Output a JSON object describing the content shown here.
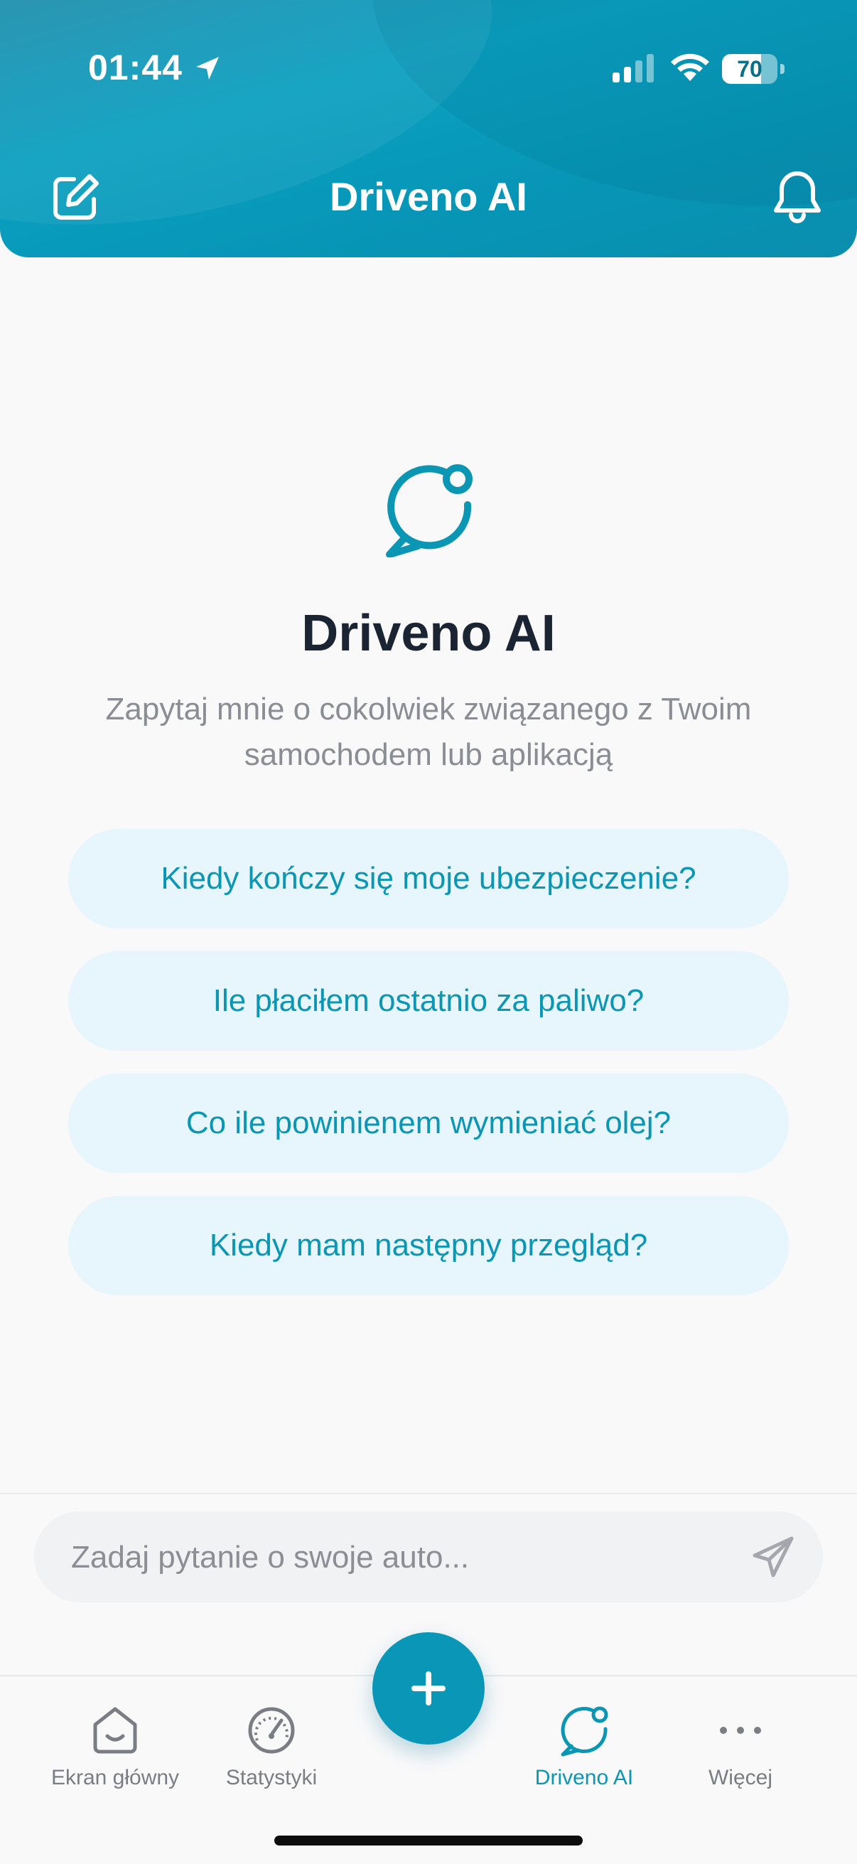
{
  "status_bar": {
    "time": "01:44",
    "battery_percent": "70",
    "battery_level": 0.7
  },
  "header": {
    "title": "Driveno AI",
    "left_icon": "compose-icon",
    "right_icon": "bell-icon"
  },
  "hero": {
    "icon": "chat-bubble-icon",
    "title": "Driveno AI",
    "subtitle": "Zapytaj mnie o cokolwiek związanego z Twoim samochodem lub aplikacją"
  },
  "suggestions": [
    "Kiedy kończy się moje ubezpieczenie?",
    "Ile płaciłem ostatnio za paliwo?",
    "Co ile powinienem wymieniać olej?",
    "Kiedy mam następny przegląd?"
  ],
  "chat_input": {
    "placeholder": "Zadaj pytanie o swoje auto...",
    "value": ""
  },
  "bottom_nav": {
    "items": [
      {
        "label": "Ekran główny",
        "icon": "home-icon",
        "active": false
      },
      {
        "label": "Statystyki",
        "icon": "speedometer-icon",
        "active": false
      },
      {
        "label": "Driveno AI",
        "icon": "chat-bubble-icon",
        "active": true
      },
      {
        "label": "Więcej",
        "icon": "more-dots-icon",
        "active": false
      }
    ],
    "fab_icon": "plus-icon"
  },
  "colors": {
    "accent": "#0b96b4",
    "header_bg": "#0aa0c0",
    "suggestion_bg": "#e6f6fc",
    "title_text": "#1b2433",
    "muted_text": "#8a8d93"
  }
}
